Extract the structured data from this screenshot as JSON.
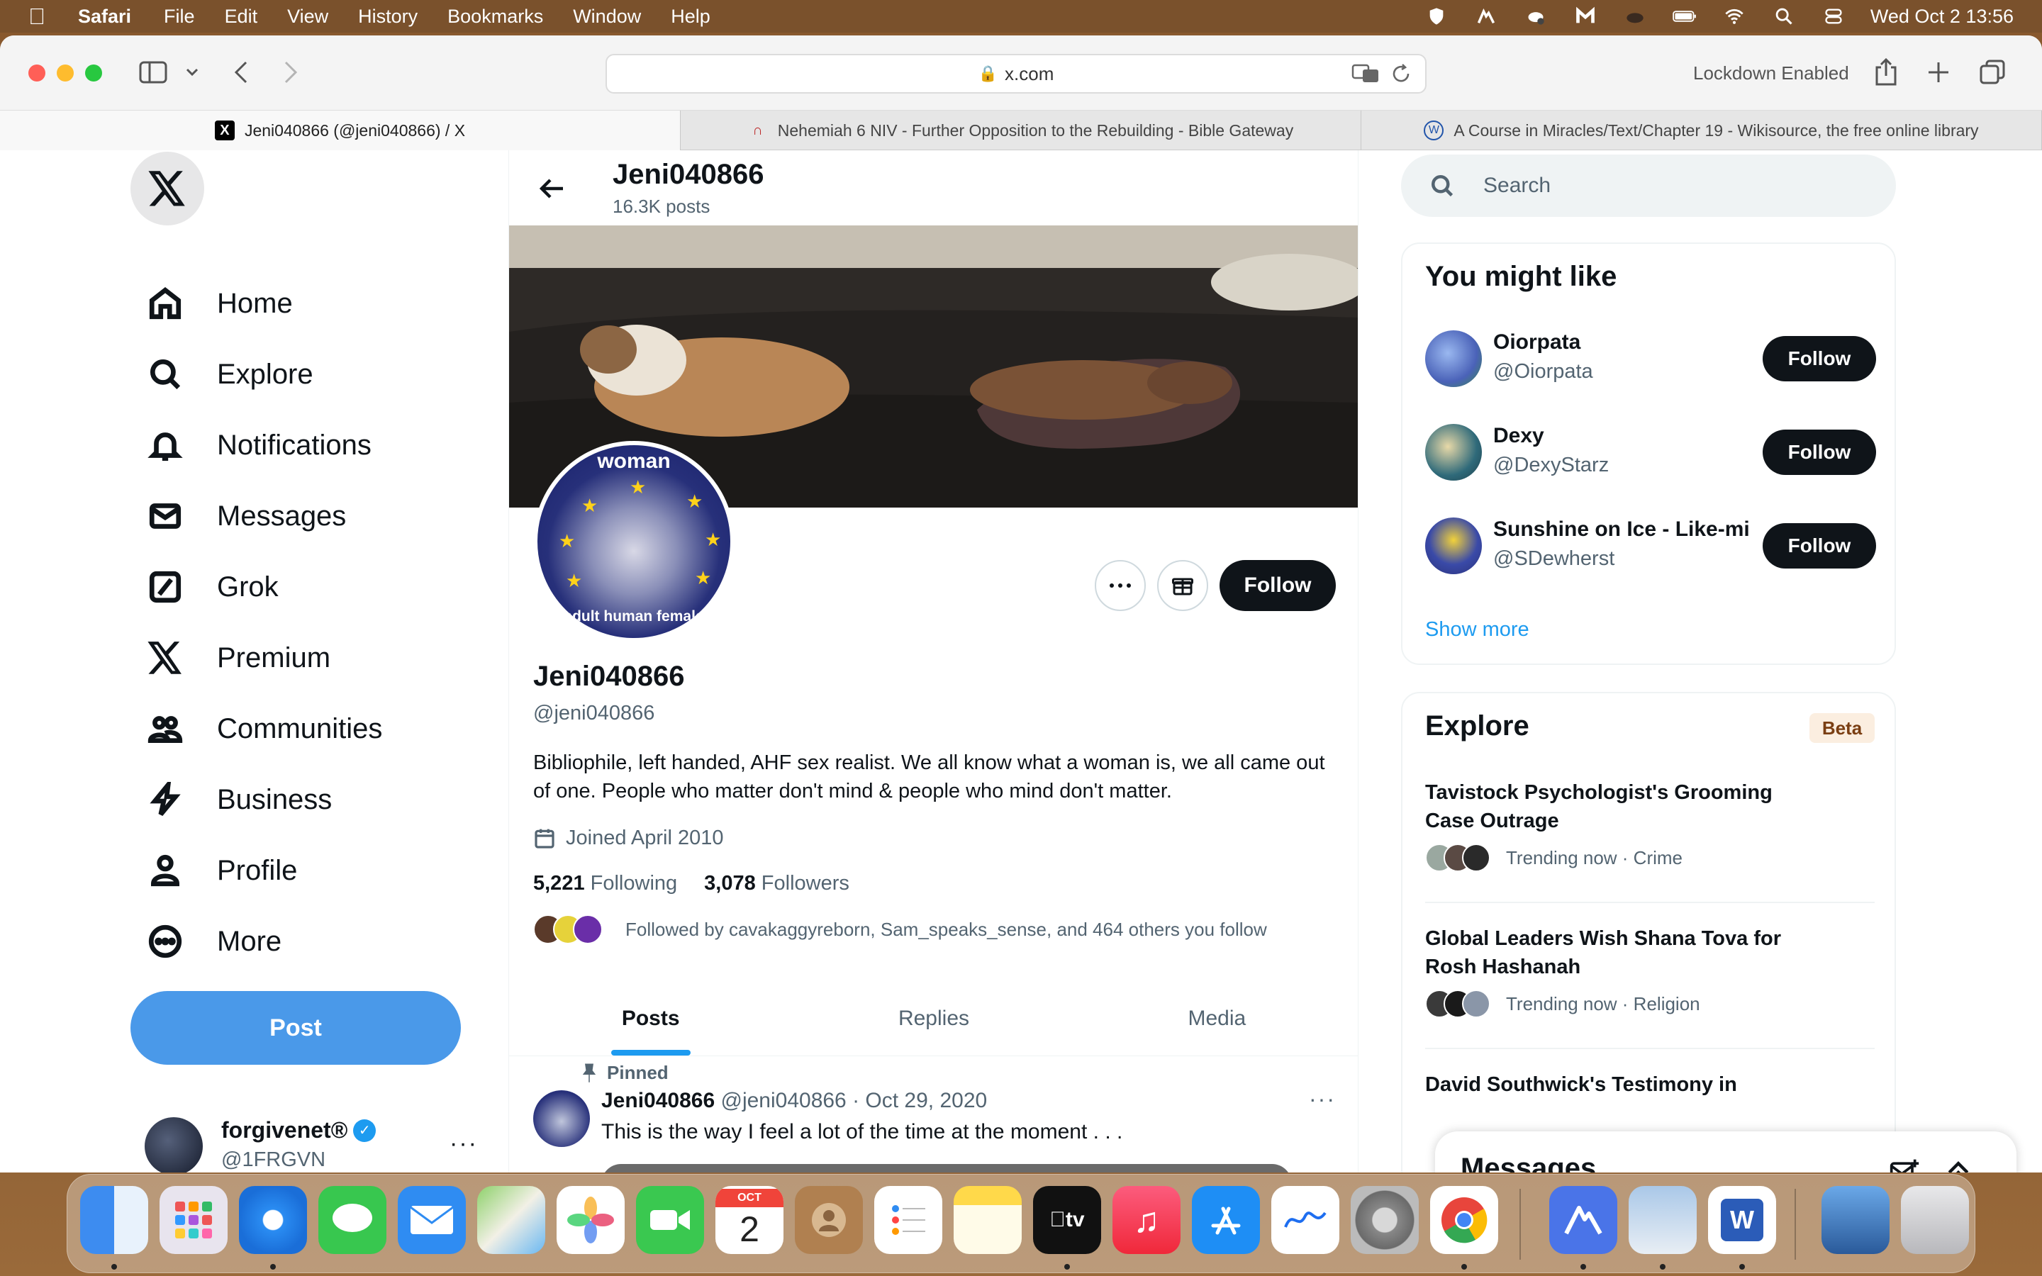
{
  "menubar": {
    "app_name": "Safari",
    "items": [
      "File",
      "Edit",
      "View",
      "History",
      "Bookmarks",
      "Window",
      "Help"
    ],
    "datetime": "Wed Oct 2  13:56"
  },
  "browser": {
    "url": "x.com",
    "lockdown_label": "Lockdown Enabled",
    "tabs": [
      {
        "title": "Jeni040866 (@jeni040866) / X",
        "icon": "x-logo-icon"
      },
      {
        "title": "Nehemiah 6 NIV - Further Opposition to the Rebuilding - Bible Gateway",
        "icon": "biblegateway-icon"
      },
      {
        "title": "A Course in Miracles/Text/Chapter 19 - Wikisource, the free online library",
        "icon": "wikisource-icon"
      }
    ]
  },
  "nav": {
    "items": [
      {
        "label": "Home",
        "icon": "home-icon"
      },
      {
        "label": "Explore",
        "icon": "search-icon"
      },
      {
        "label": "Notifications",
        "icon": "bell-icon"
      },
      {
        "label": "Messages",
        "icon": "envelope-icon"
      },
      {
        "label": "Grok",
        "icon": "grok-icon"
      },
      {
        "label": "Premium",
        "icon": "x-logo-icon"
      },
      {
        "label": "Communities",
        "icon": "people-icon"
      },
      {
        "label": "Business",
        "icon": "lightning-icon"
      },
      {
        "label": "Profile",
        "icon": "person-icon"
      },
      {
        "label": "More",
        "icon": "more-circle-icon"
      }
    ],
    "post_label": "Post",
    "account": {
      "name": "forgivenet®",
      "handle": "@1FRGVN"
    }
  },
  "profile": {
    "header_name": "Jeni040866",
    "post_count": "16.3K posts",
    "avatar_top_text": "woman",
    "avatar_bottom_text": "adult human female",
    "name": "Jeni040866",
    "handle": "@jeni040866",
    "bio": "Bibliophile, left handed, AHF sex realist. We all know what a woman is, we all came out of one. People who matter don't mind & people who mind don't matter.",
    "joined": "Joined April 2010",
    "following_count": "5,221",
    "following_label": "Following",
    "followers_count": "3,078",
    "followers_label": "Followers",
    "followed_by": "Followed by cavakaggyreborn, Sam_speaks_sense, and 464 others you follow",
    "follow_label": "Follow",
    "tabs": [
      "Posts",
      "Replies",
      "Media"
    ]
  },
  "pinned_tweet": {
    "pinned_label": "Pinned",
    "author": "Jeni040866",
    "handle": "@jeni040866",
    "date": "Oct 29, 2020",
    "text": "This is the way I feel a lot of the time at the moment . . ."
  },
  "search": {
    "placeholder": "Search"
  },
  "you_might_like": {
    "title": "You might like",
    "accounts": [
      {
        "name": "Oiorpata",
        "handle": "@Oiorpata",
        "button": "Follow",
        "avatar_color": "#6a8fd8"
      },
      {
        "name": "Dexy",
        "handle": "@DexyStarz",
        "button": "Follow",
        "avatar_color": "#2f6a7a"
      },
      {
        "name": "Sunshine on Ice - Like-minded",
        "handle": "@SDewherst",
        "button": "Follow",
        "avatar_color": "#3a4aa8"
      }
    ],
    "show_more": "Show more"
  },
  "explore": {
    "title": "Explore",
    "badge": "Beta",
    "trends": [
      {
        "title": "Tavistock Psychologist's Grooming Case Outrage",
        "meta": "Trending now · Crime"
      },
      {
        "title": "Global Leaders Wish Shana Tova for Rosh Hashanah",
        "meta": "Trending now · Religion"
      },
      {
        "title": "David Southwick's Testimony in",
        "meta": ""
      }
    ]
  },
  "messages_drawer": {
    "title": "Messages"
  },
  "dock": {
    "calendar_month": "OCT",
    "calendar_day": "2",
    "apps": [
      "Finder",
      "Launchpad",
      "Safari",
      "Messages",
      "Mail",
      "Maps",
      "Photos",
      "FaceTime",
      "Calendar",
      "Contacts",
      "Reminders",
      "Notes",
      "TV",
      "Music",
      "App Store",
      "Freeform",
      "System Settings",
      "Chrome",
      "NordVPN",
      "Preview",
      "Word",
      "Downloads",
      "Trash"
    ]
  }
}
